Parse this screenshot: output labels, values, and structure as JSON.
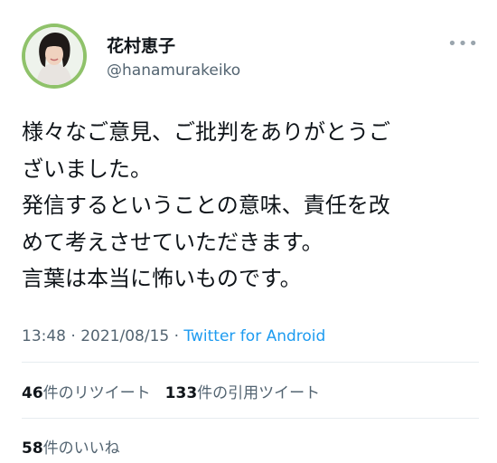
{
  "author": {
    "display_name": "花村恵子",
    "handle": "@hanamurakeiko"
  },
  "more_icon": "more-horizontal-icon",
  "tweet": {
    "text": "様々なご意見、ご批判をありがとうご\nざいました。\n発信するということの意味、責任を改\nめて考えさせていただきます。\n言葉は本当に怖いものです。"
  },
  "meta": {
    "time": "13:48",
    "dot1": " · ",
    "date": "2021/08/15",
    "dot2": " · ",
    "source": "Twitter for Android"
  },
  "stats": {
    "retweets_count": "46",
    "retweets_label": "件のリツイート",
    "quotes_count": "133",
    "quotes_label": "件の引用ツイート",
    "likes_count": "58",
    "likes_label": "件のいいね"
  },
  "colors": {
    "text": "#0f1419",
    "secondary": "#536471",
    "link": "#1d9bf0",
    "avatar_ring": "#8fc26a"
  }
}
